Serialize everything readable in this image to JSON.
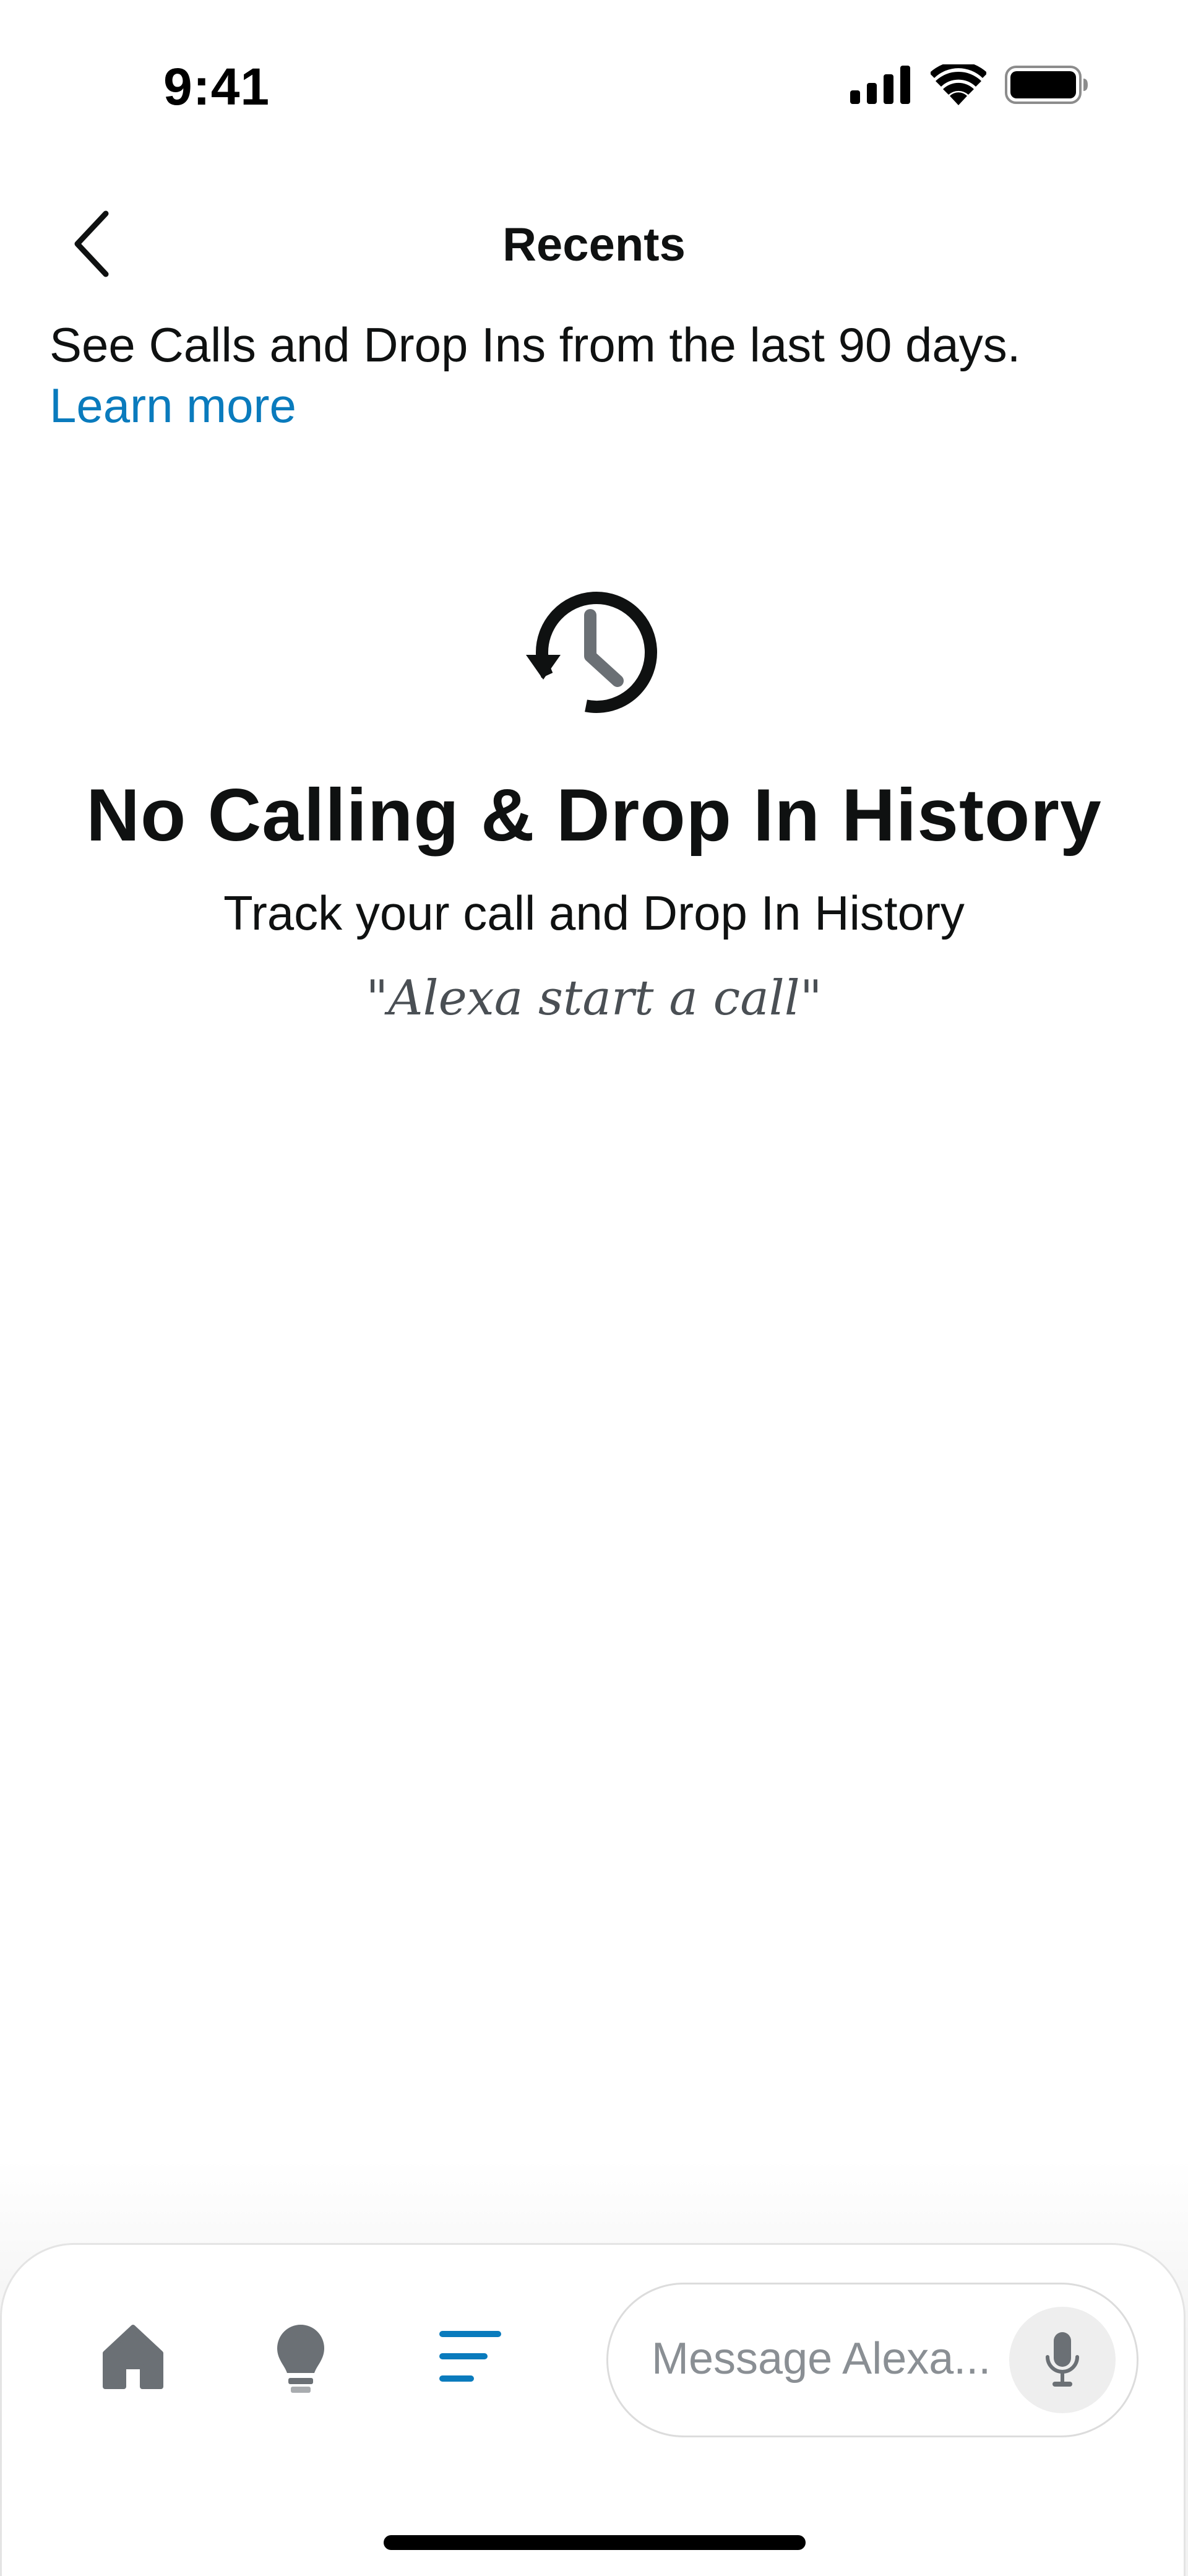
{
  "status_bar": {
    "time": "9:41",
    "icons": [
      "cellular-signal-icon",
      "wifi-icon",
      "battery-icon"
    ]
  },
  "header": {
    "title": "Recents",
    "back_icon": "chevron-left-icon"
  },
  "intro": {
    "text": "See Calls and Drop Ins from the last 90 days.",
    "link_label": "Learn more"
  },
  "empty_state": {
    "icon": "history-clock-icon",
    "title": "No Calling & Drop In History",
    "subtitle": "Track your call and Drop In History",
    "hint": "\"Alexa start a call\""
  },
  "bottom_nav": {
    "items": [
      {
        "icon": "home-icon",
        "active": false
      },
      {
        "icon": "lightbulb-icon",
        "active": false
      },
      {
        "icon": "menu-lines-icon",
        "active": true
      }
    ],
    "message_placeholder": "Message Alexa...",
    "mic_icon": "microphone-icon"
  },
  "colors": {
    "text": "#0f1111",
    "link": "#0a7bbd",
    "active_nav": "#0a7bbd",
    "inactive_nav": "#6b7075",
    "hint_text": "#4a4f54",
    "placeholder": "#8a8f94"
  }
}
